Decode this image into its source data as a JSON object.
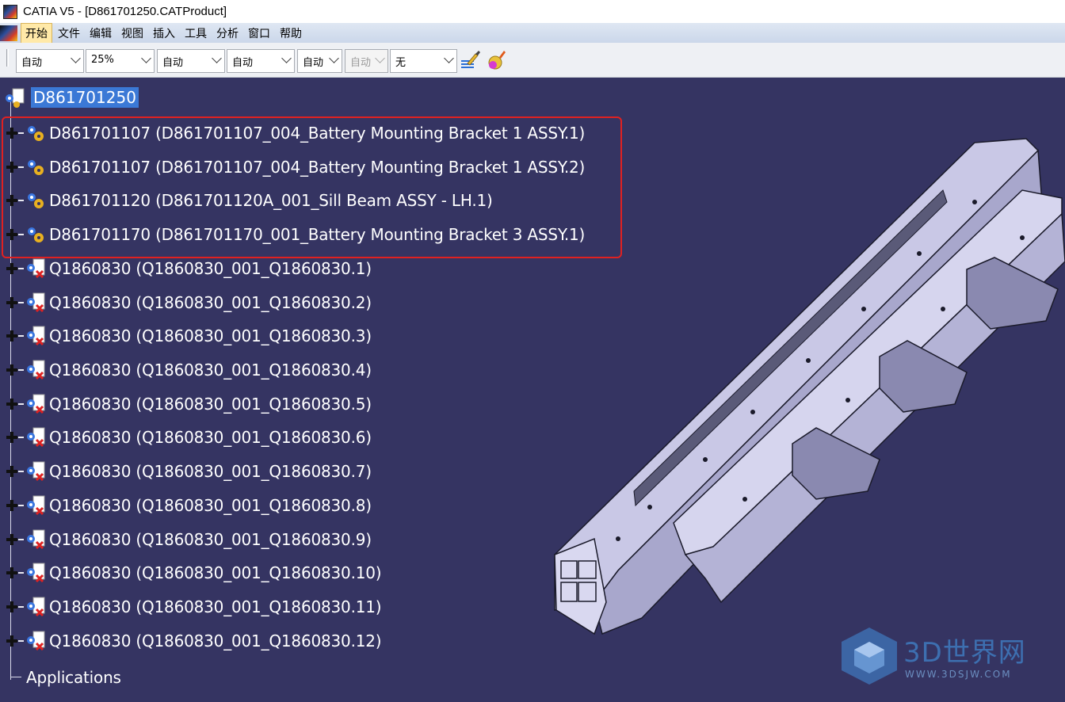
{
  "window": {
    "title": "CATIA V5 - [D861701250.CATProduct]"
  },
  "menu": {
    "items": [
      "开始",
      "文件",
      "编辑",
      "视图",
      "插入",
      "工具",
      "分析",
      "窗口",
      "帮助"
    ]
  },
  "toolbar": {
    "combos": [
      {
        "value": "自动",
        "enabled": true
      },
      {
        "value": "25%",
        "enabled": true
      },
      {
        "value": "自动",
        "enabled": true
      },
      {
        "value": "自动",
        "enabled": true
      },
      {
        "value": "自动",
        "enabled": true
      },
      {
        "value": "自动",
        "enabled": false
      },
      {
        "value": "无",
        "enabled": true
      }
    ],
    "icons": [
      "paint-brush-icon",
      "apply-material-icon"
    ]
  },
  "tree": {
    "root": "D861701250",
    "rows": [
      "D861701107 (D861701107_004_Battery Mounting Bracket 1 ASSY.1)",
      "D861701107 (D861701107_004_Battery Mounting Bracket 1 ASSY.2)",
      "D861701120 (D861701120A_001_Sill Beam ASSY - LH.1)",
      "D861701170 (D861701170_001_Battery Mounting Bracket 3 ASSY.1)",
      "Q1860830 (Q1860830_001_Q1860830.1)",
      "Q1860830 (Q1860830_001_Q1860830.2)",
      "Q1860830 (Q1860830_001_Q1860830.3)",
      "Q1860830 (Q1860830_001_Q1860830.4)",
      "Q1860830 (Q1860830_001_Q1860830.5)",
      "Q1860830 (Q1860830_001_Q1860830.6)",
      "Q1860830 (Q1860830_001_Q1860830.7)",
      "Q1860830 (Q1860830_001_Q1860830.8)",
      "Q1860830 (Q1860830_001_Q1860830.9)",
      "Q1860830 (Q1860830_001_Q1860830.10)",
      "Q1860830 (Q1860830_001_Q1860830.11)",
      "Q1860830 (Q1860830_001_Q1860830.12)"
    ],
    "applications": "Applications"
  },
  "watermark": {
    "brand": "3D世界网",
    "url": "WWW.3DSJW.COM"
  },
  "colors": {
    "viewport_bg": "#353462",
    "selection": "#3b79d6",
    "highlight_box": "#e02121"
  }
}
